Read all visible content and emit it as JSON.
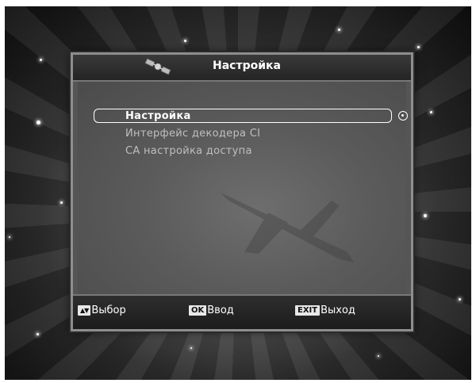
{
  "window": {
    "title": "Настройка"
  },
  "menu": {
    "items": [
      {
        "label": "Настройка",
        "selected": true
      },
      {
        "label": "Интерфейс декодера CI",
        "selected": false
      },
      {
        "label": "СА настройка доступа",
        "selected": false
      }
    ]
  },
  "footer": {
    "select_key": "▲▼",
    "select_label": "Выбор",
    "ok_key": "OK",
    "ok_label": "Ввод",
    "exit_key": "EXIT",
    "exit_label": "Выход"
  },
  "icons": {
    "title": "satellite-icon",
    "enter": "enter-circle-icon"
  }
}
